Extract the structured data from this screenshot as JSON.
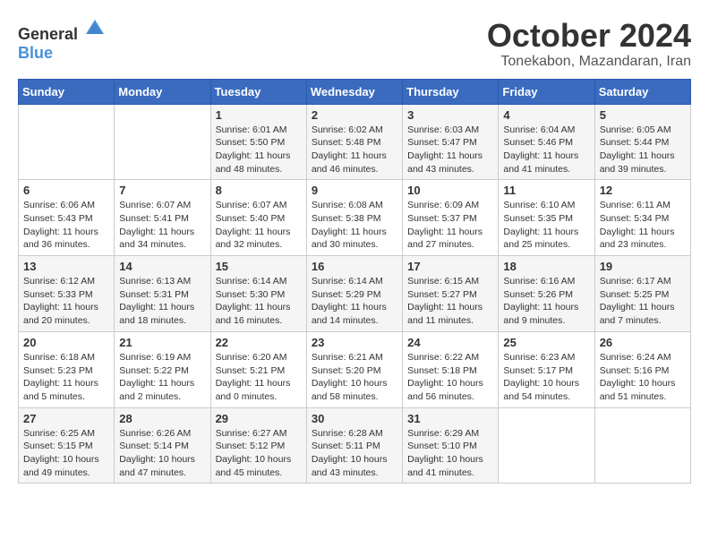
{
  "header": {
    "logo_general": "General",
    "logo_blue": "Blue",
    "month": "October 2024",
    "location": "Tonekabon, Mazandaran, Iran"
  },
  "days_of_week": [
    "Sunday",
    "Monday",
    "Tuesday",
    "Wednesday",
    "Thursday",
    "Friday",
    "Saturday"
  ],
  "weeks": [
    [
      {
        "day": "",
        "sunrise": "",
        "sunset": "",
        "daylight": ""
      },
      {
        "day": "",
        "sunrise": "",
        "sunset": "",
        "daylight": ""
      },
      {
        "day": "1",
        "sunrise": "Sunrise: 6:01 AM",
        "sunset": "Sunset: 5:50 PM",
        "daylight": "Daylight: 11 hours and 48 minutes."
      },
      {
        "day": "2",
        "sunrise": "Sunrise: 6:02 AM",
        "sunset": "Sunset: 5:48 PM",
        "daylight": "Daylight: 11 hours and 46 minutes."
      },
      {
        "day": "3",
        "sunrise": "Sunrise: 6:03 AM",
        "sunset": "Sunset: 5:47 PM",
        "daylight": "Daylight: 11 hours and 43 minutes."
      },
      {
        "day": "4",
        "sunrise": "Sunrise: 6:04 AM",
        "sunset": "Sunset: 5:46 PM",
        "daylight": "Daylight: 11 hours and 41 minutes."
      },
      {
        "day": "5",
        "sunrise": "Sunrise: 6:05 AM",
        "sunset": "Sunset: 5:44 PM",
        "daylight": "Daylight: 11 hours and 39 minutes."
      }
    ],
    [
      {
        "day": "6",
        "sunrise": "Sunrise: 6:06 AM",
        "sunset": "Sunset: 5:43 PM",
        "daylight": "Daylight: 11 hours and 36 minutes."
      },
      {
        "day": "7",
        "sunrise": "Sunrise: 6:07 AM",
        "sunset": "Sunset: 5:41 PM",
        "daylight": "Daylight: 11 hours and 34 minutes."
      },
      {
        "day": "8",
        "sunrise": "Sunrise: 6:07 AM",
        "sunset": "Sunset: 5:40 PM",
        "daylight": "Daylight: 11 hours and 32 minutes."
      },
      {
        "day": "9",
        "sunrise": "Sunrise: 6:08 AM",
        "sunset": "Sunset: 5:38 PM",
        "daylight": "Daylight: 11 hours and 30 minutes."
      },
      {
        "day": "10",
        "sunrise": "Sunrise: 6:09 AM",
        "sunset": "Sunset: 5:37 PM",
        "daylight": "Daylight: 11 hours and 27 minutes."
      },
      {
        "day": "11",
        "sunrise": "Sunrise: 6:10 AM",
        "sunset": "Sunset: 5:35 PM",
        "daylight": "Daylight: 11 hours and 25 minutes."
      },
      {
        "day": "12",
        "sunrise": "Sunrise: 6:11 AM",
        "sunset": "Sunset: 5:34 PM",
        "daylight": "Daylight: 11 hours and 23 minutes."
      }
    ],
    [
      {
        "day": "13",
        "sunrise": "Sunrise: 6:12 AM",
        "sunset": "Sunset: 5:33 PM",
        "daylight": "Daylight: 11 hours and 20 minutes."
      },
      {
        "day": "14",
        "sunrise": "Sunrise: 6:13 AM",
        "sunset": "Sunset: 5:31 PM",
        "daylight": "Daylight: 11 hours and 18 minutes."
      },
      {
        "day": "15",
        "sunrise": "Sunrise: 6:14 AM",
        "sunset": "Sunset: 5:30 PM",
        "daylight": "Daylight: 11 hours and 16 minutes."
      },
      {
        "day": "16",
        "sunrise": "Sunrise: 6:14 AM",
        "sunset": "Sunset: 5:29 PM",
        "daylight": "Daylight: 11 hours and 14 minutes."
      },
      {
        "day": "17",
        "sunrise": "Sunrise: 6:15 AM",
        "sunset": "Sunset: 5:27 PM",
        "daylight": "Daylight: 11 hours and 11 minutes."
      },
      {
        "day": "18",
        "sunrise": "Sunrise: 6:16 AM",
        "sunset": "Sunset: 5:26 PM",
        "daylight": "Daylight: 11 hours and 9 minutes."
      },
      {
        "day": "19",
        "sunrise": "Sunrise: 6:17 AM",
        "sunset": "Sunset: 5:25 PM",
        "daylight": "Daylight: 11 hours and 7 minutes."
      }
    ],
    [
      {
        "day": "20",
        "sunrise": "Sunrise: 6:18 AM",
        "sunset": "Sunset: 5:23 PM",
        "daylight": "Daylight: 11 hours and 5 minutes."
      },
      {
        "day": "21",
        "sunrise": "Sunrise: 6:19 AM",
        "sunset": "Sunset: 5:22 PM",
        "daylight": "Daylight: 11 hours and 2 minutes."
      },
      {
        "day": "22",
        "sunrise": "Sunrise: 6:20 AM",
        "sunset": "Sunset: 5:21 PM",
        "daylight": "Daylight: 11 hours and 0 minutes."
      },
      {
        "day": "23",
        "sunrise": "Sunrise: 6:21 AM",
        "sunset": "Sunset: 5:20 PM",
        "daylight": "Daylight: 10 hours and 58 minutes."
      },
      {
        "day": "24",
        "sunrise": "Sunrise: 6:22 AM",
        "sunset": "Sunset: 5:18 PM",
        "daylight": "Daylight: 10 hours and 56 minutes."
      },
      {
        "day": "25",
        "sunrise": "Sunrise: 6:23 AM",
        "sunset": "Sunset: 5:17 PM",
        "daylight": "Daylight: 10 hours and 54 minutes."
      },
      {
        "day": "26",
        "sunrise": "Sunrise: 6:24 AM",
        "sunset": "Sunset: 5:16 PM",
        "daylight": "Daylight: 10 hours and 51 minutes."
      }
    ],
    [
      {
        "day": "27",
        "sunrise": "Sunrise: 6:25 AM",
        "sunset": "Sunset: 5:15 PM",
        "daylight": "Daylight: 10 hours and 49 minutes."
      },
      {
        "day": "28",
        "sunrise": "Sunrise: 6:26 AM",
        "sunset": "Sunset: 5:14 PM",
        "daylight": "Daylight: 10 hours and 47 minutes."
      },
      {
        "day": "29",
        "sunrise": "Sunrise: 6:27 AM",
        "sunset": "Sunset: 5:12 PM",
        "daylight": "Daylight: 10 hours and 45 minutes."
      },
      {
        "day": "30",
        "sunrise": "Sunrise: 6:28 AM",
        "sunset": "Sunset: 5:11 PM",
        "daylight": "Daylight: 10 hours and 43 minutes."
      },
      {
        "day": "31",
        "sunrise": "Sunrise: 6:29 AM",
        "sunset": "Sunset: 5:10 PM",
        "daylight": "Daylight: 10 hours and 41 minutes."
      },
      {
        "day": "",
        "sunrise": "",
        "sunset": "",
        "daylight": ""
      },
      {
        "day": "",
        "sunrise": "",
        "sunset": "",
        "daylight": ""
      }
    ]
  ]
}
